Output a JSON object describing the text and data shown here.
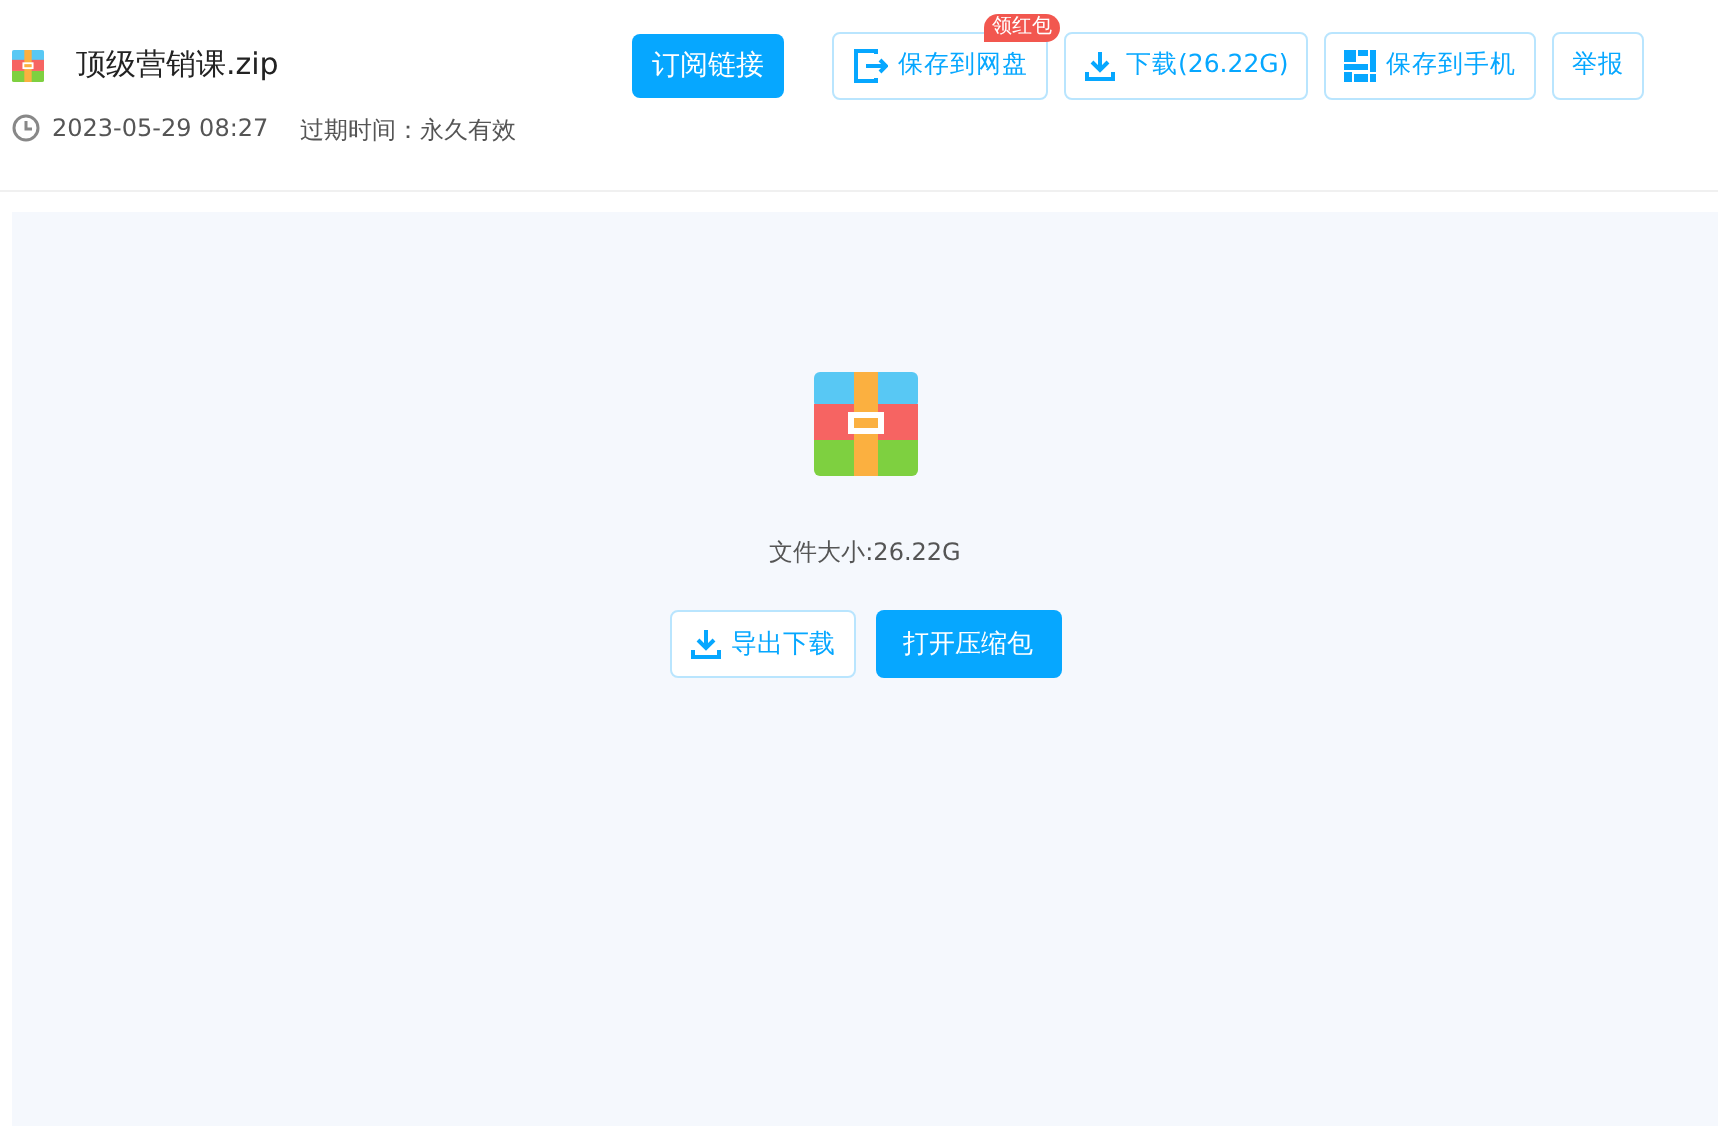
{
  "file": {
    "name": "顶级营销课.zip",
    "date": "2023-05-29 08:27",
    "expiry": "过期时间：永久有效"
  },
  "subscribe": "订阅链接",
  "actions": [
    {
      "kind": "cloud",
      "label": "保存到网盘",
      "badge": "领红包"
    },
    {
      "kind": "download",
      "label": "下载(26.22G)"
    },
    {
      "kind": "phone",
      "label": "保存到手机"
    },
    {
      "kind": "plain",
      "label": "举报"
    }
  ],
  "preview": {
    "size": "文件大小:26.22G",
    "export": "导出下载",
    "open": "打开压缩包"
  }
}
